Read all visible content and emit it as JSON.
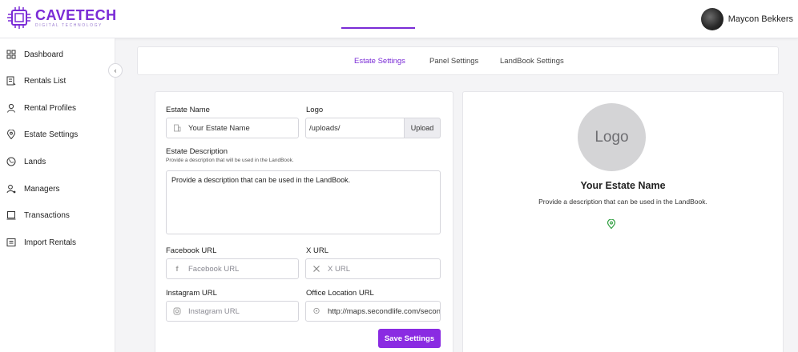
{
  "brand": {
    "name": "CAVETECH",
    "tagline": "DIGITAL TECHNOLOGY",
    "accent": "#7a2bd6",
    "button_color": "#8a2be2"
  },
  "user": {
    "name": "Maycon Bekkers"
  },
  "sidebar": {
    "items": [
      {
        "label": "Dashboard",
        "icon": "grid-icon"
      },
      {
        "label": "Rentals List",
        "icon": "list-icon"
      },
      {
        "label": "Rental Profiles",
        "icon": "user-icon"
      },
      {
        "label": "Estate Settings",
        "icon": "location-icon"
      },
      {
        "label": "Lands",
        "icon": "globe-icon"
      },
      {
        "label": "Managers",
        "icon": "manager-icon"
      },
      {
        "label": "Transactions",
        "icon": "receipt-icon"
      },
      {
        "label": "Import Rentals",
        "icon": "import-icon"
      }
    ],
    "collapse_glyph": "‹"
  },
  "tabs": [
    {
      "label": "Estate Settings",
      "active": true
    },
    {
      "label": "Panel Settings",
      "active": false
    },
    {
      "label": "LandBook Settings",
      "active": false
    }
  ],
  "form": {
    "estate_name": {
      "label": "Estate Name",
      "value": "Your Estate Name"
    },
    "logo": {
      "label": "Logo",
      "value": "/uploads/",
      "upload_label": "Upload"
    },
    "description": {
      "label": "Estate Description",
      "hint": "Provide a description that will be used in the LandBook.",
      "value": "Provide a description that can be used in the LandBook."
    },
    "facebook": {
      "label": "Facebook URL",
      "placeholder": "Facebook URL"
    },
    "x": {
      "label": "X URL",
      "placeholder": "X URL"
    },
    "instagram": {
      "label": "Instagram URL",
      "placeholder": "Instagram URL"
    },
    "office": {
      "label": "Office Location URL",
      "value": "http://maps.secondlife.com/secon"
    },
    "save_label": "Save Settings"
  },
  "preview": {
    "logo_text": "Logo",
    "name": "Your Estate Name",
    "description": "Provide a description that can be used in the LandBook.",
    "pin_color": "#2e9e3e"
  }
}
